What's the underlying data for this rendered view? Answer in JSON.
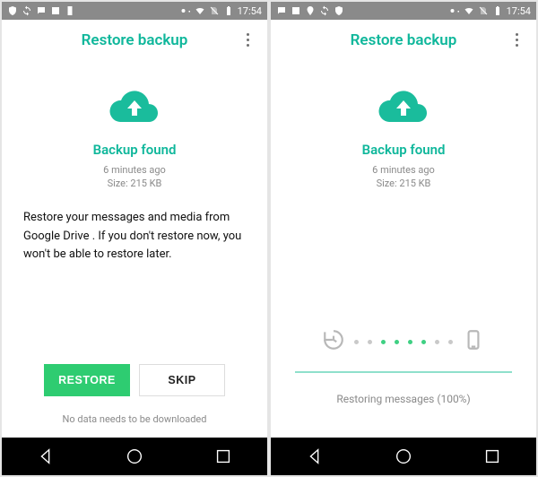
{
  "statusbar": {
    "time": "17:54"
  },
  "left": {
    "appbar_title": "Restore backup",
    "found_title": "Backup found",
    "meta_line1": "6 minutes ago",
    "meta_line2": "Size: 215 KB",
    "description": "Restore your messages and media from Google Drive . If you don't restore now, you won't be able to restore later.",
    "restore_label": "RESTORE",
    "skip_label": "SKIP",
    "footnote": "No data needs to be downloaded"
  },
  "right": {
    "appbar_title": "Restore backup",
    "found_title": "Backup found",
    "meta_line1": "6 minutes ago",
    "meta_line2": "Size: 215 KB",
    "progress_text": "Restoring messages (100%)"
  },
  "colors": {
    "brand": "#0fb79b",
    "primary_btn": "#2ecc71"
  }
}
